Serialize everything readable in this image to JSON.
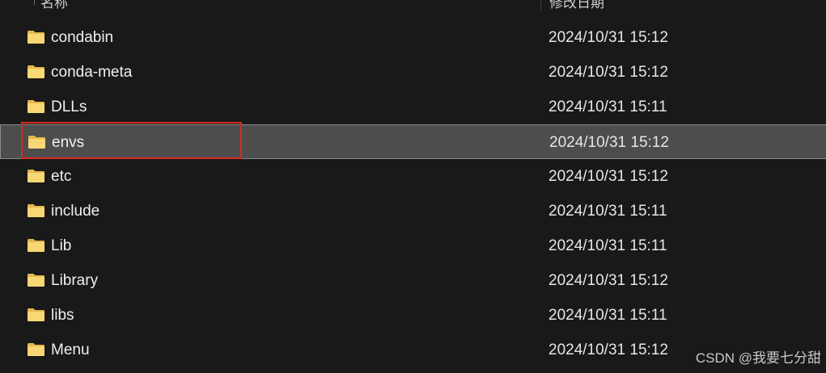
{
  "header": {
    "name_column": "名称",
    "date_column": "修改日期"
  },
  "files": [
    {
      "name": "condabin",
      "modified": "2024/10/31 15:12",
      "icon": "folder-icon",
      "selected": false
    },
    {
      "name": "conda-meta",
      "modified": "2024/10/31 15:12",
      "icon": "folder-icon",
      "selected": false
    },
    {
      "name": "DLLs",
      "modified": "2024/10/31 15:11",
      "icon": "folder-icon",
      "selected": false
    },
    {
      "name": "envs",
      "modified": "2024/10/31 15:12",
      "icon": "folder-icon",
      "selected": true
    },
    {
      "name": "etc",
      "modified": "2024/10/31 15:12",
      "icon": "folder-icon",
      "selected": false
    },
    {
      "name": "include",
      "modified": "2024/10/31 15:11",
      "icon": "folder-icon",
      "selected": false
    },
    {
      "name": "Lib",
      "modified": "2024/10/31 15:11",
      "icon": "folder-icon",
      "selected": false
    },
    {
      "name": "Library",
      "modified": "2024/10/31 15:12",
      "icon": "folder-icon",
      "selected": false
    },
    {
      "name": "libs",
      "modified": "2024/10/31 15:11",
      "icon": "folder-icon",
      "selected": false
    },
    {
      "name": "Menu",
      "modified": "2024/10/31 15:12",
      "icon": "folder-icon",
      "selected": false
    }
  ],
  "annotation": {
    "highlight_color": "#d92a1c"
  },
  "watermark": "CSDN @我要七分甜",
  "colors": {
    "background": "#191919",
    "selected_row": "#4d4d4d",
    "folder_front": "#f8d775",
    "folder_back": "#e6b84a"
  }
}
